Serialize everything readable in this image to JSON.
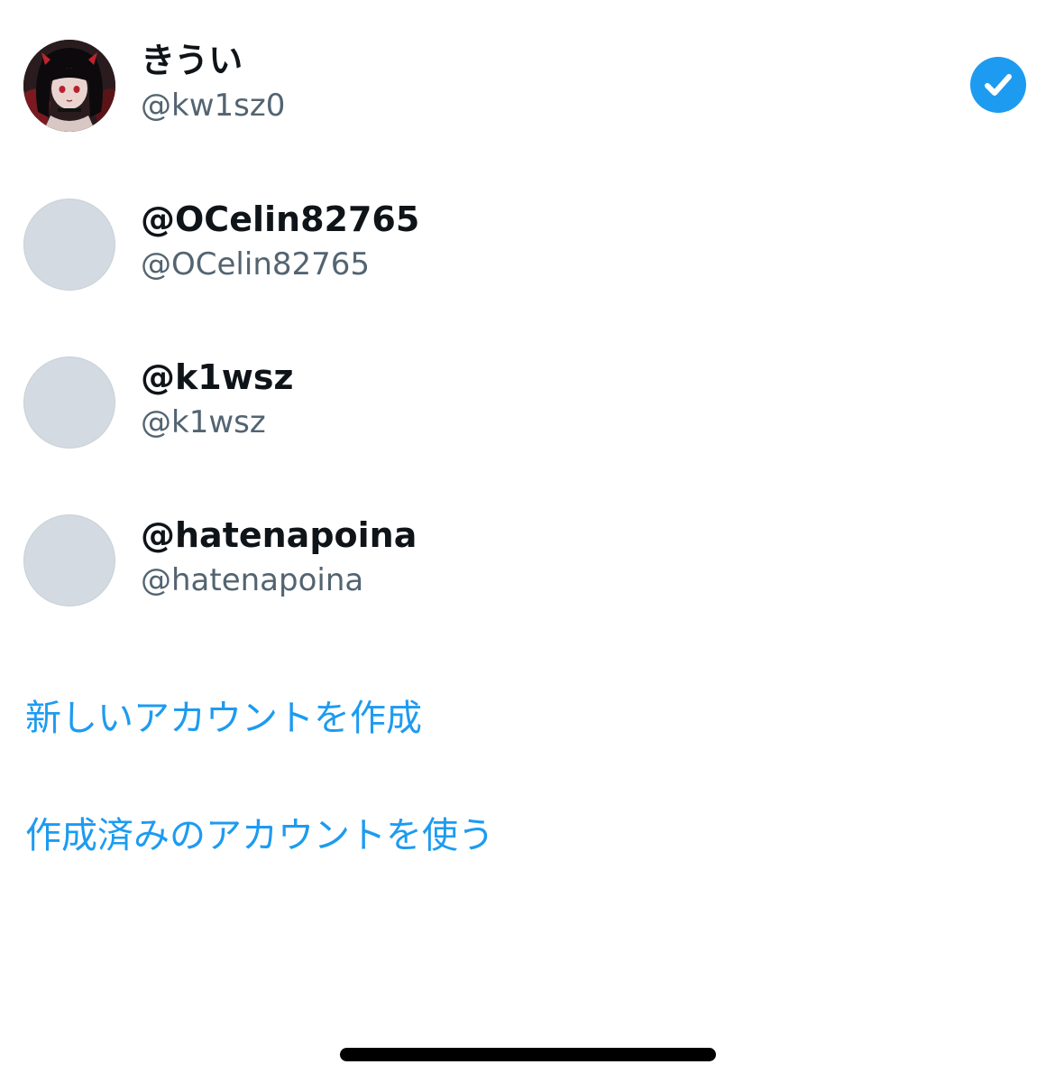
{
  "accounts": [
    {
      "display_name": "きうい",
      "handle": "@kw1sz0",
      "avatar": "anime-character-photo",
      "selected": true
    },
    {
      "display_name": "@OCelin82765",
      "handle": "@OCelin82765",
      "avatar": "default-placeholder",
      "selected": false
    },
    {
      "display_name": "@k1wsz",
      "handle": "@k1wsz",
      "avatar": "default-placeholder",
      "selected": false
    },
    {
      "display_name": "@hatenapoina",
      "handle": "@hatenapoina",
      "avatar": "default-placeholder",
      "selected": false
    }
  ],
  "actions": {
    "create_new_account": "新しいアカウントを作成",
    "use_existing_account": "作成済みのアカウントを使う"
  },
  "icons": {
    "selected_badge": "checkmark-circle-icon"
  },
  "colors": {
    "accent": "#1d9bf0",
    "primary_text": "#0f1419",
    "secondary_text": "#536471",
    "placeholder_avatar": "#d3dae1",
    "home_indicator": "#000000"
  }
}
